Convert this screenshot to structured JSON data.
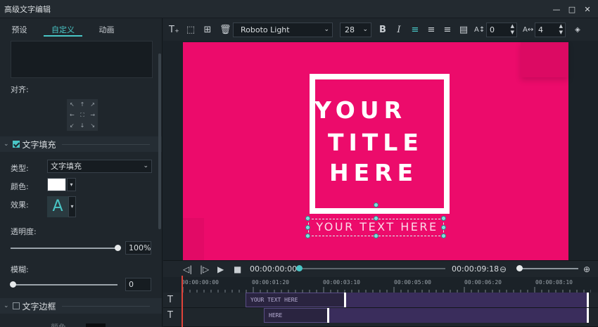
{
  "window": {
    "title": "高级文字编辑",
    "controls": [
      "—",
      "□",
      "✕"
    ]
  },
  "left_panel": {
    "tabs": [
      {
        "label": "预设"
      },
      {
        "label": "自定义"
      },
      {
        "label": "动画"
      }
    ],
    "align_label": "对齐:",
    "align_glyphs": [
      "↖",
      "↑",
      "↗",
      "←",
      "⛶",
      "→",
      "↙",
      "↓",
      "↘"
    ],
    "fill_section": {
      "title": "文字填充",
      "checked": true
    },
    "type_label": "类型:",
    "type_value": "文字填充",
    "color_label": "颜色:",
    "effect_label": "效果:",
    "effect_glyph": "A",
    "opacity_label": "透明度:",
    "opacity_value": "100%",
    "opacity_level": 1.0,
    "blur_label": "模糊:",
    "blur_value": "0",
    "blur_level": 0.0,
    "border_section": {
      "title": "文字边框",
      "checked": false
    },
    "bottom_label": "颜色"
  },
  "toolbar": {
    "font": "Roboto Light",
    "size": "28",
    "bold": "B",
    "italic": "I",
    "letter_spacing": "0",
    "line_spacing": "4"
  },
  "preview": {
    "lines": [
      "YOUR",
      "TITLE",
      "HERE"
    ],
    "subtitle": "YOUR TEXT HERE",
    "bg_color": "#ec0b6b"
  },
  "transport": {
    "current_time": "00:00:00:00",
    "total_time": "00:00:09:18"
  },
  "timeline": {
    "ruler_labels": [
      "00:00:00:00",
      "00:00:01:20",
      "00:00:03:10",
      "00:00:05:00",
      "00:00:06:20",
      "00:00:08:10"
    ],
    "tracks": [
      {
        "icon": "T",
        "clip_label": "YOUR TEXT HERE"
      },
      {
        "icon": "T",
        "clip_label": "HERE"
      }
    ]
  }
}
